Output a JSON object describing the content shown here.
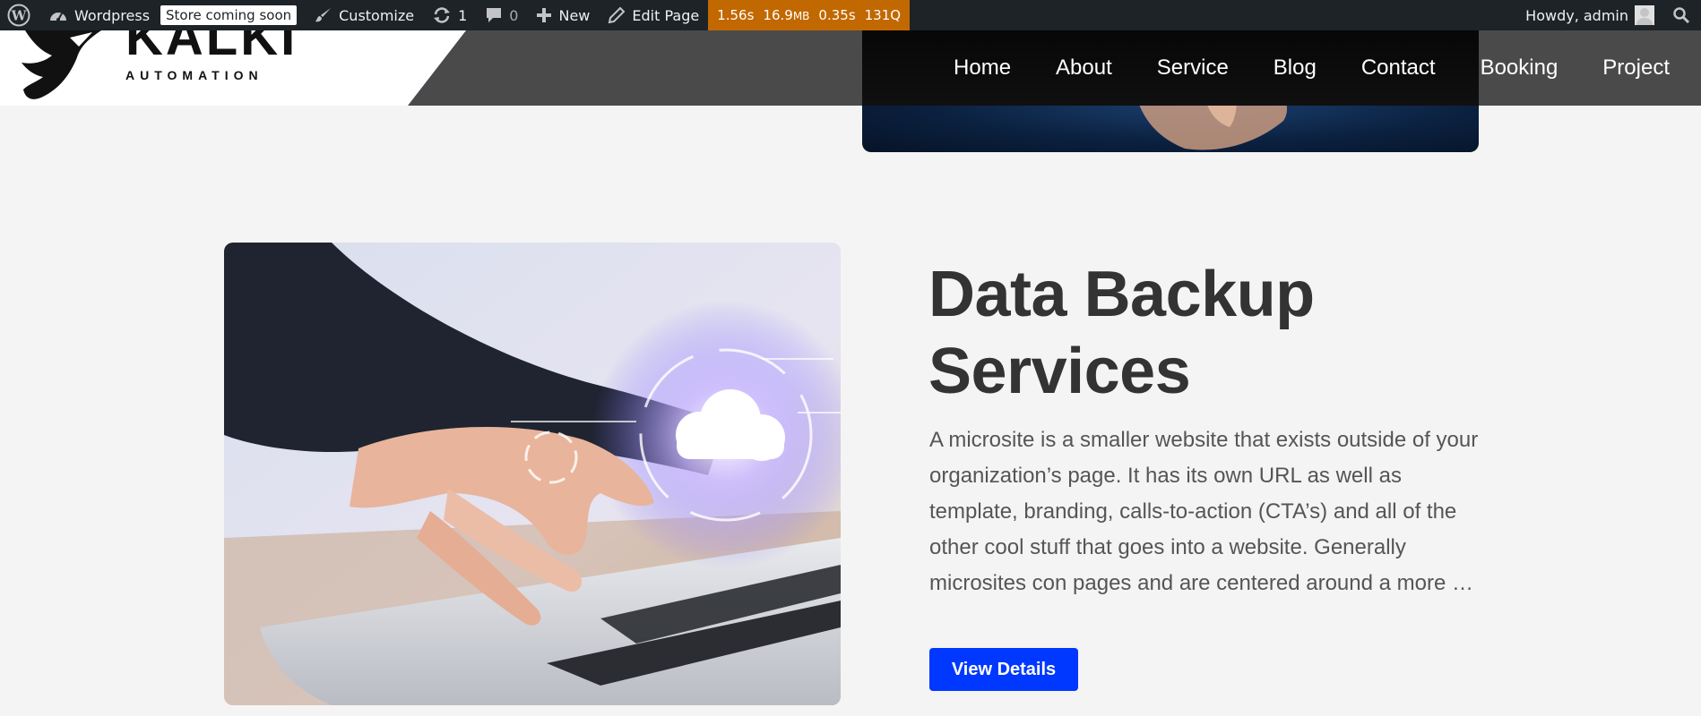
{
  "admin_bar": {
    "site_name": "Wordpress",
    "store_badge": "Store coming soon",
    "customize": "Customize",
    "updates_count": "1",
    "comments_count": "0",
    "new_label": "New",
    "edit_page": "Edit Page",
    "perf": {
      "time": "1.56s",
      "memory": "16.9",
      "memory_unit": "MB",
      "query_time": "0.35s",
      "queries": "131Q"
    },
    "greeting": "Howdy, admin"
  },
  "header": {
    "logo_text": "KALKI",
    "logo_sub": "AUTOMATION",
    "nav": [
      "Home",
      "About",
      "Service",
      "Blog",
      "Contact",
      "Booking",
      "Project"
    ]
  },
  "service": {
    "title": "Data Backup Services",
    "description": "A microsite is a smaller website that exists outside of your organization’s page. It has its own URL as well as template, branding, calls-to-action (CTA’s) and all of the other cool stuff that goes into a website. Generally microsites con pages and are centered around a more …",
    "button": "View Details"
  },
  "colors": {
    "admin_bar_bg": "#1d2327",
    "perf_bg": "#c26800",
    "accent": "#3b5bfa",
    "button": "#0038ff",
    "header_bg": "#4a4a4a",
    "page_bg": "#f4f4f4"
  },
  "icons": [
    "wordpress-icon",
    "dashboard-icon",
    "brush-icon",
    "refresh-icon",
    "comment-icon",
    "plus-icon",
    "pencil-icon",
    "search-icon"
  ]
}
